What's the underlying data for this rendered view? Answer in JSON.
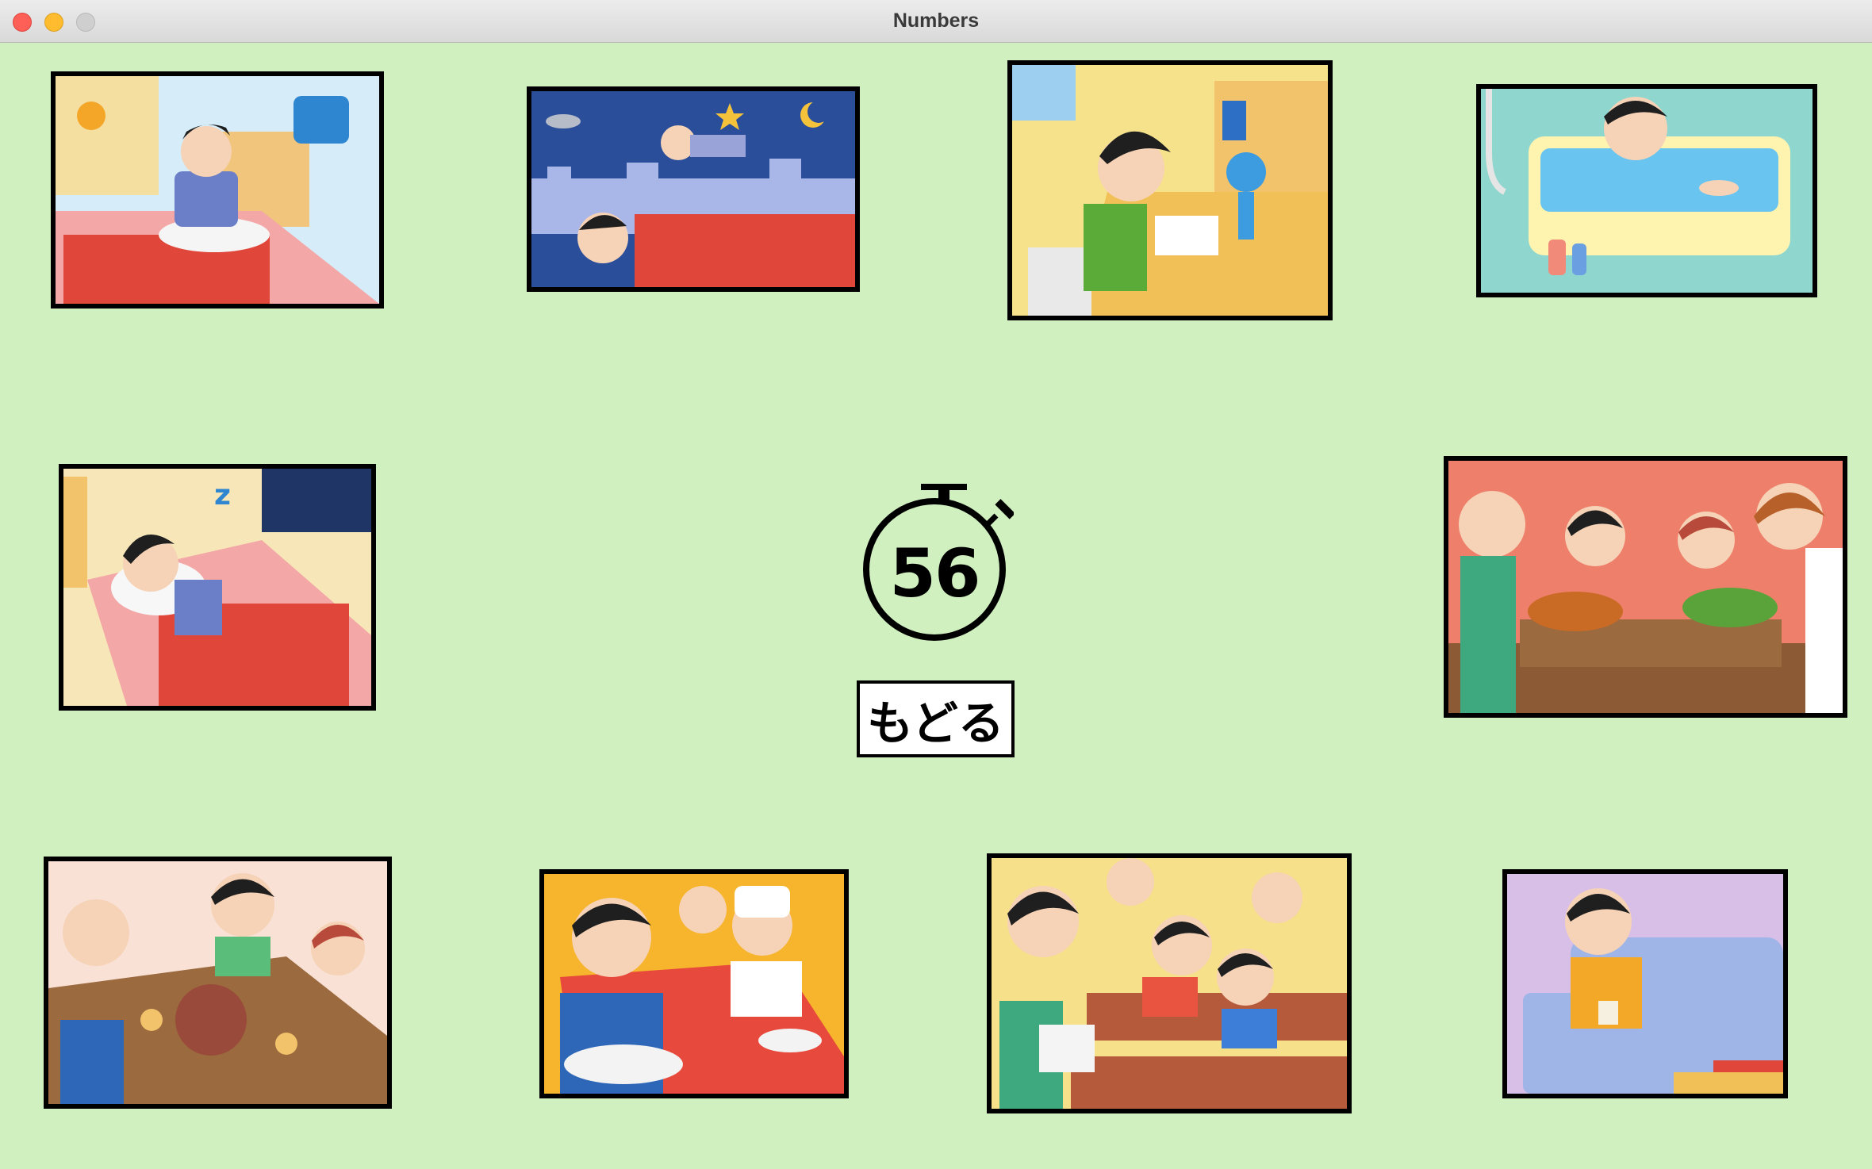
{
  "window": {
    "title": "Numbers"
  },
  "timer": {
    "value": "56"
  },
  "back_button": {
    "label": "もどる"
  },
  "background_color": "#d1f0c0",
  "scenes": [
    {
      "name": "scene-waking-up",
      "icon": "waking-up"
    },
    {
      "name": "scene-dreaming",
      "icon": "dreaming"
    },
    {
      "name": "scene-studying",
      "icon": "studying"
    },
    {
      "name": "scene-bathing",
      "icon": "bathing"
    },
    {
      "name": "scene-sleeping",
      "icon": "sleeping"
    },
    {
      "name": "scene-family-dinner",
      "icon": "family-dinner"
    },
    {
      "name": "scene-family-breakfast",
      "icon": "family-breakfast"
    },
    {
      "name": "scene-school-lunch",
      "icon": "school-lunch"
    },
    {
      "name": "scene-classroom",
      "icon": "classroom"
    },
    {
      "name": "scene-relaxing-sofa",
      "icon": "relaxing-sofa"
    }
  ]
}
